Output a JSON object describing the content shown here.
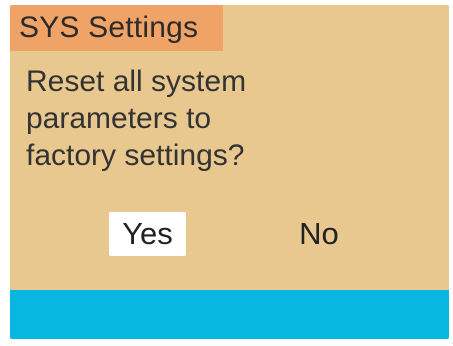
{
  "dialog": {
    "title": "SYS Settings",
    "message_lines": [
      "Reset all system",
      "parameters to",
      "factory settings?"
    ],
    "buttons": {
      "yes_label": "Yes",
      "no_label": "No",
      "selected": "Yes"
    }
  },
  "colors": {
    "background": "#e8c88f",
    "title_bar": "#f0a366",
    "status_bar": "#08b6e2",
    "selected_button": "#ffffff"
  }
}
